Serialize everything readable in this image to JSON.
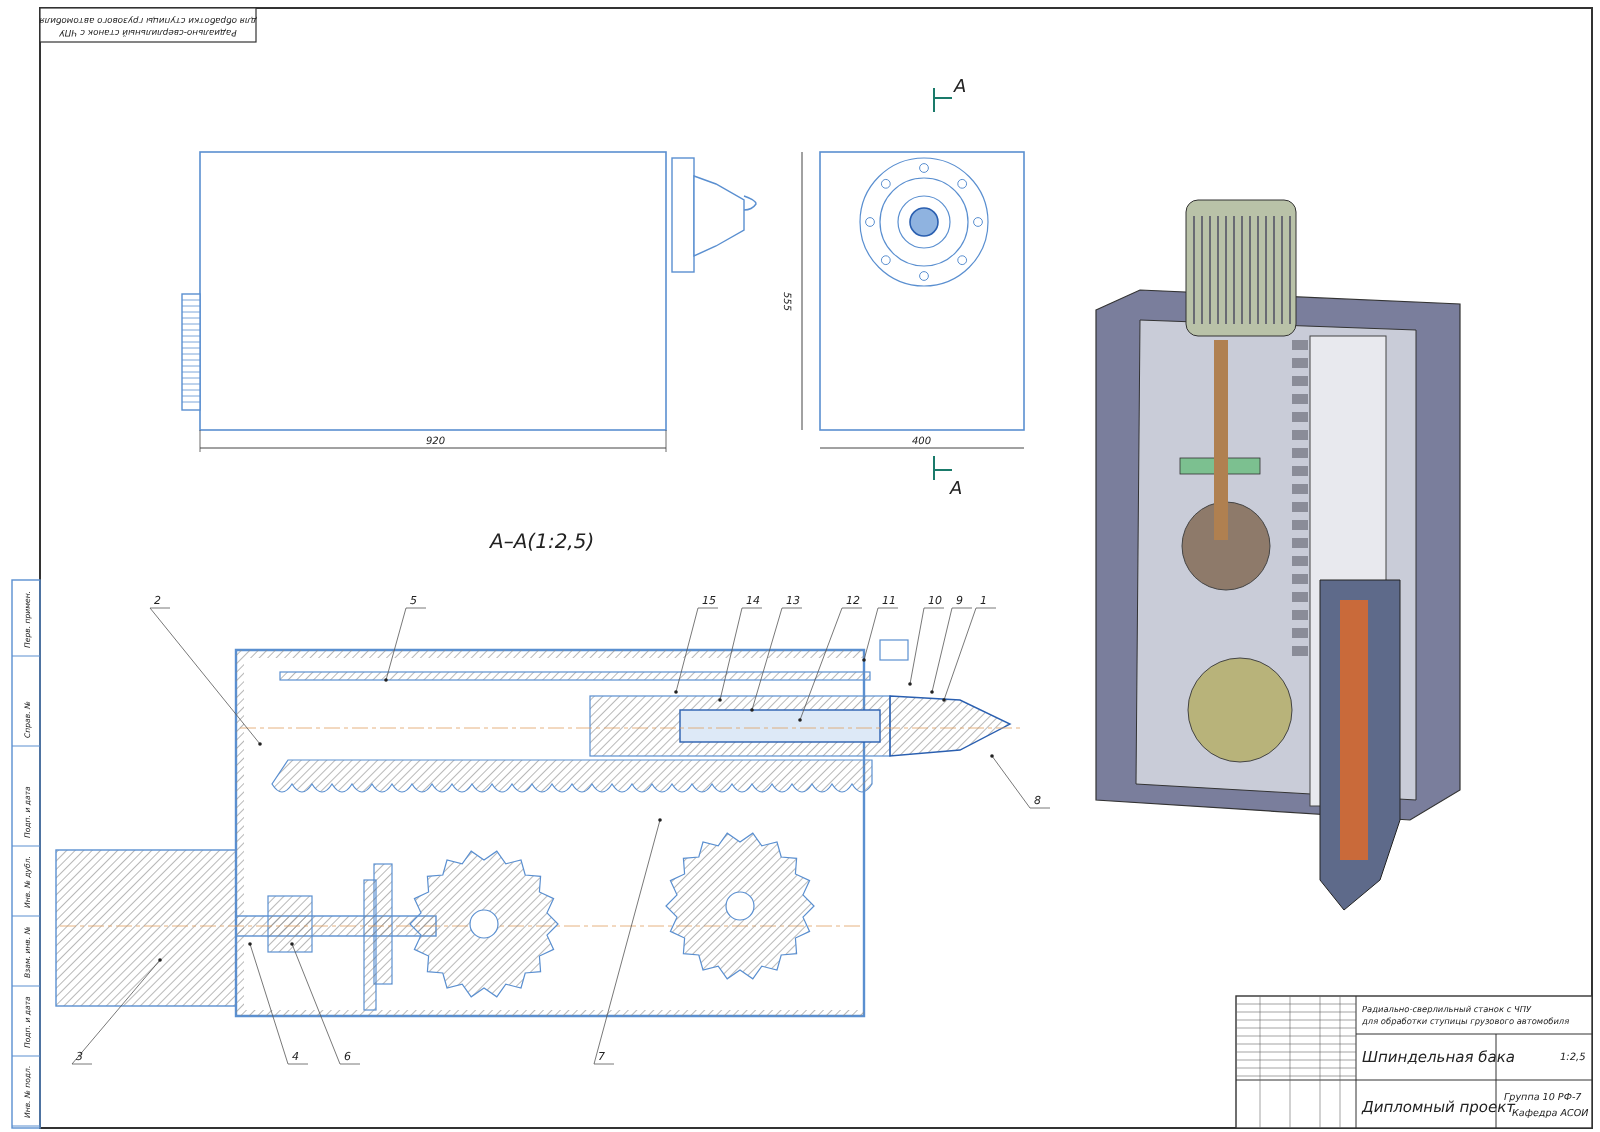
{
  "sheet_stamp": [
    "Радиально-сверлильный станок с ЧПУ",
    "для обработки ступицы грузового автомобиля"
  ],
  "front_view": {
    "length_dimension": "920"
  },
  "side_view": {
    "width_dimension": "400",
    "height_dimension": "555",
    "section_marks": [
      "А",
      "А"
    ]
  },
  "section": {
    "title": "А–А(1:2,5)",
    "callouts": [
      {
        "label": "2"
      },
      {
        "label": "5"
      },
      {
        "label": "15"
      },
      {
        "label": "14"
      },
      {
        "label": "13"
      },
      {
        "label": "12"
      },
      {
        "label": "11"
      },
      {
        "label": "10"
      },
      {
        "label": "9"
      },
      {
        "label": "1"
      },
      {
        "label": "8"
      },
      {
        "label": "3"
      },
      {
        "label": "4"
      },
      {
        "label": "6"
      },
      {
        "label": "7"
      }
    ]
  },
  "side_strip": [
    "Перв. примен.",
    "Справ. №",
    "Подп. и дата",
    "Инв. № дубл.",
    "Взам. инв. №",
    "Подп. и дата",
    "Инв. № подл."
  ],
  "title_block": {
    "subject": [
      "Радиально-сверлильный станок с ЧПУ",
      "для обработки ступицы грузового автомобиля"
    ],
    "drawing_name": "Шпиндельная бака",
    "document": "Дипломный проект",
    "scale": "1:2,5",
    "group": "Группа 10 РФ-7",
    "department": "Кафедра АСОИ"
  }
}
